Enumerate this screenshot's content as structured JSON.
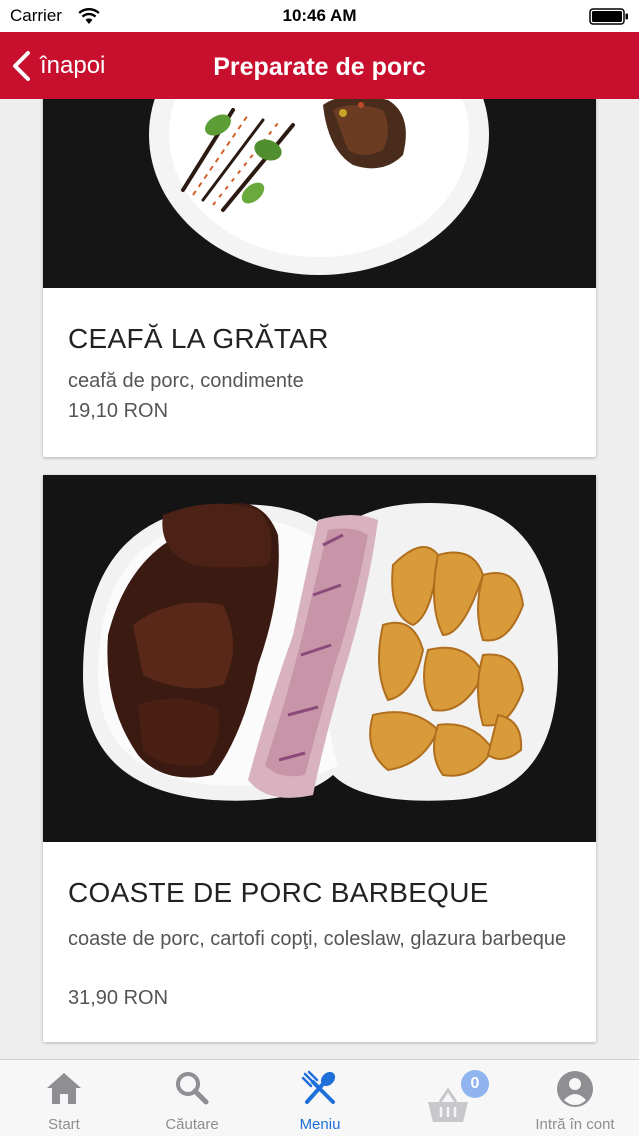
{
  "status_bar": {
    "carrier": "Carrier",
    "time": "10:46 AM"
  },
  "nav": {
    "back_label": "înapoi",
    "title": "Preparate de porc",
    "color": "#c8102e"
  },
  "products": [
    {
      "title": "CEAFĂ LA GRĂTAR",
      "description": "ceafă de porc, condimente",
      "price": "19,10 RON"
    },
    {
      "title": "COASTE DE PORC BARBEQUE",
      "description": "coaste de porc, cartofi copţi, coleslaw, glazura barbeque",
      "price": "31,90 RON"
    }
  ],
  "tabs": [
    {
      "label": "Start",
      "icon": "home-icon",
      "active": false
    },
    {
      "label": "Căutare",
      "icon": "search-icon",
      "active": false
    },
    {
      "label": "Meniu",
      "icon": "cutlery-icon",
      "active": true
    },
    {
      "label": "",
      "icon": "basket-icon",
      "active": false,
      "badge": "0"
    },
    {
      "label": "Intră în cont",
      "icon": "user-icon",
      "active": false
    }
  ],
  "colors": {
    "active_tab": "#1e6fd9",
    "inactive_tab": "#8e8e93",
    "badge": "#8fb4f0"
  }
}
